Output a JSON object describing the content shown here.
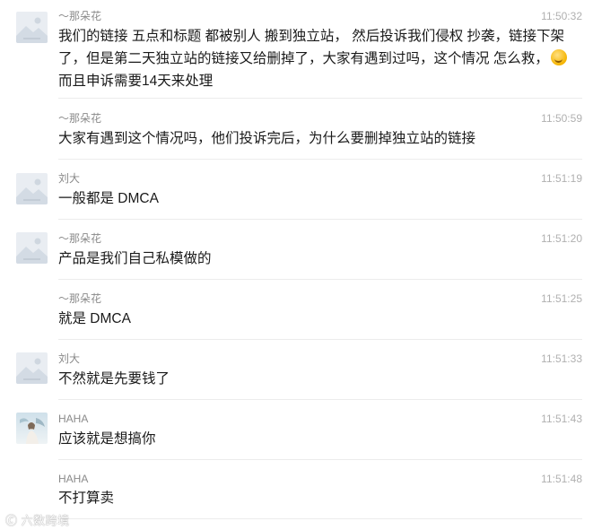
{
  "messages": [
    {
      "sender": "～那朵花",
      "time": "11:50:32",
      "avatar": "placeholder-image-icon",
      "lines": [
        "我们的链接 五点和标题 都被别人 搬到独立站，  然后投诉我们侵权 抄袭，链接下架",
        "了，但是第二天独立站的链接又给删掉了，大家有遇到过吗，这个情况 怎么救，",
        "而且申诉需要14天来处理"
      ],
      "emoji": "sweat-smile-emoji"
    },
    {
      "sender": "～那朵花",
      "time": "11:50:59",
      "lines": [
        "大家有遇到这个情况吗，他们投诉完后，为什么要删掉独立站的链接"
      ]
    },
    {
      "sender": "刘大",
      "time": "11:51:19",
      "avatar": "placeholder-image-icon",
      "lines": [
        "一般都是 DMCA"
      ]
    },
    {
      "sender": "～那朵花",
      "time": "11:51:20",
      "avatar": "placeholder-image-icon",
      "lines": [
        "产品是我们自己私模做的"
      ]
    },
    {
      "sender": "～那朵花",
      "time": "11:51:25",
      "lines": [
        "就是 DMCA"
      ]
    },
    {
      "sender": "刘大",
      "time": "11:51:33",
      "avatar": "placeholder-image-icon",
      "lines": [
        "不然就是先要钱了"
      ]
    },
    {
      "sender": "HAHA",
      "time": "11:51:43",
      "avatar": "photo-avatar",
      "lines": [
        "应该就是想搞你"
      ]
    },
    {
      "sender": "HAHA",
      "time": "11:51:48",
      "lines": [
        "不打算卖"
      ]
    }
  ],
  "watermark": "🄫 六数跨境",
  "colors": {
    "sender": "#8a8a8a",
    "time": "#b0b0b0",
    "text": "#1a1a1a",
    "divider": "#ececec"
  }
}
